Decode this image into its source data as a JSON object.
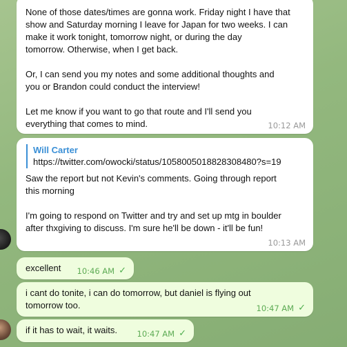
{
  "messages": [
    {
      "text": "None of those dates/times are gonna work. Friday night I have that\nshow and Saturday morning I leave for Japan for two weeks. I can\nmake it work tonight, tomorrow night, or during the day\ntomorrow. Otherwise, when I get back.\n\nOr, I can send you my notes and some additional thoughts and\nyou or Brandon could conduct the interview!\n\nLet me know if you want to go that route and I'll send you\neverything that comes to mind.",
      "time": "10:12 AM"
    },
    {
      "reply_name": "Will Carter",
      "reply_text": "https://twitter.com/owocki/status/1058005018828308480?s=19",
      "text": "Saw the report but not Kevin's comments. Going through report\nthis morning\n\nI'm going to respond on Twitter and try and set up mtg in boulder\nafter thxgiving to discuss. I'm sure he'll be down - it'll be fun!",
      "time": "10:13 AM"
    },
    {
      "text": "excellent",
      "time": "10:46 AM"
    },
    {
      "text": "i cant do tonite, i can do tomorrow, but daniel is flying out\ntomorrow too.",
      "time": "10:47 AM"
    },
    {
      "text": "if it has to wait, it waits.",
      "time": "10:47 AM"
    }
  ],
  "icons": {
    "read_receipt": "double-check-icon"
  },
  "colors": {
    "incoming_bubble": "#ffffff",
    "outgoing_bubble": "#effdde",
    "reply_accent": "#3a8fd6",
    "check": "#4fae4e"
  }
}
